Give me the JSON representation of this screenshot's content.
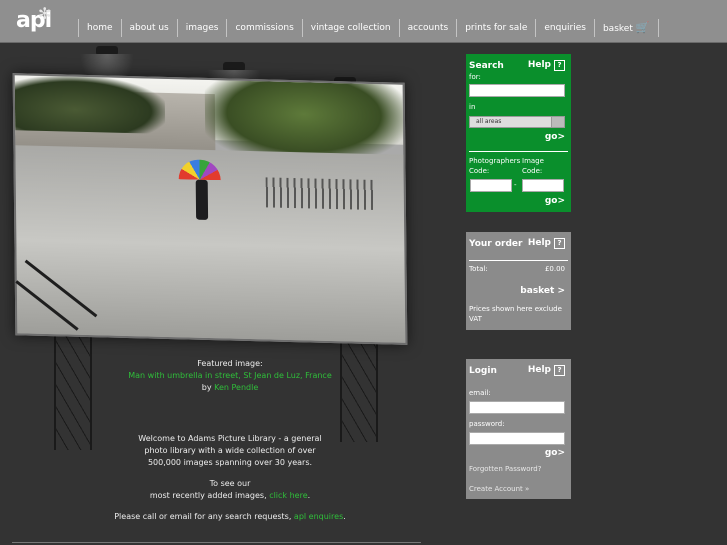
{
  "header": {
    "logo": "apl",
    "nav": [
      "home",
      "about us",
      "images",
      "commissions",
      "vintage collection",
      "accounts",
      "prints for sale",
      "enquiries",
      "basket"
    ]
  },
  "featured": {
    "label": "Featured image:",
    "title": "Man with umbrella in street, St Jean de Luz, France",
    "by": "by",
    "author": "Ken Pendle"
  },
  "welcome": {
    "line1": "Welcome to Adams Picture Library - a general",
    "line2": "photo library with a wide collection of over",
    "line3": "500,000 images spanning over 30 years.",
    "see1": "To see our",
    "see2": "most recently added images,",
    "see_link": "click here",
    "see_end": ".",
    "call": "Please call or email for any search requests,",
    "call_link": "apl enquires",
    "call_end": "."
  },
  "search": {
    "title": "Search",
    "help": "Help",
    "help_q": "?",
    "for": "for:",
    "in": "in",
    "area": "all areas",
    "go": "go>",
    "photographers_code": "Photographers Code:",
    "image_code": "Image Code:",
    "dash": "-",
    "go2": "go>"
  },
  "order": {
    "title": "Your order",
    "help": "Help",
    "help_q": "?",
    "total_label": "Total:",
    "total_value": "£0.00",
    "basket": "basket >",
    "note": "Prices shown here exclude VAT"
  },
  "login": {
    "title": "Login",
    "help": "Help",
    "help_q": "?",
    "email": "email:",
    "password": "password:",
    "go": "go>",
    "forgot": "Forgotten Password?",
    "create": "Create Account »"
  },
  "colors": {
    "search_bg": "#0a8f2c",
    "panel_bg": "#8b8b8b",
    "page_bg": "#333333",
    "link": "#2fbf3a"
  }
}
